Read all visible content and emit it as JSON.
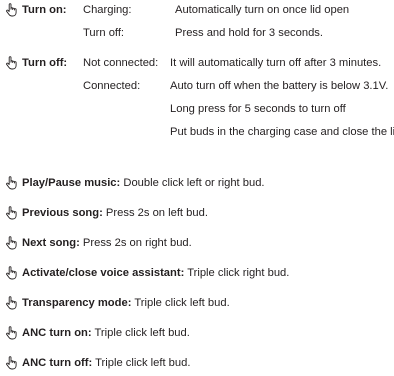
{
  "power": [
    {
      "heading": "Turn on:",
      "rows": [
        {
          "condition": "Charging:",
          "action": "Automatically turn on once lid open"
        },
        {
          "condition": "Turn off:",
          "action": "Press and hold for 3 seconds."
        }
      ]
    },
    {
      "heading": "Turn off:",
      "rows": [
        {
          "condition": "Not connected:",
          "action": "It will automatically turn off after 3 minutes."
        },
        {
          "condition": "Connected:",
          "action": "Auto turn off when the battery is below 3.1V."
        },
        {
          "condition": "",
          "action": "Long press for 5 seconds to turn off"
        },
        {
          "condition": "",
          "action": "Put buds in the charging case and close the lid."
        }
      ]
    }
  ],
  "controls": [
    {
      "label": "Play/Pause music:",
      "text": " Double click left or right bud."
    },
    {
      "label": "Previous song:",
      "text": " Press 2s on left bud."
    },
    {
      "label": "Next song:",
      "text": " Press 2s on right bud."
    },
    {
      "label": "Activate/close voice assistant:",
      "text": " Triple click right bud."
    },
    {
      "label": "Transparency mode:",
      "text": " Triple click left bud."
    },
    {
      "label": "ANC turn on:",
      "text": " Triple click left bud."
    },
    {
      "label": "ANC turn off:",
      "text": " Triple click left bud."
    }
  ],
  "icon": "pointing-hand-icon",
  "colors": {
    "text": "#231f20"
  }
}
